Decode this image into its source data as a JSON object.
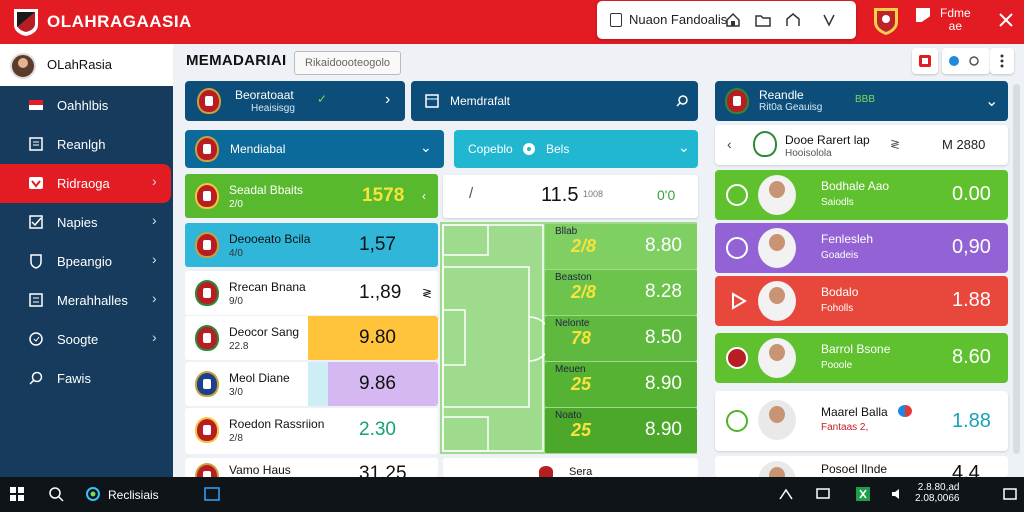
{
  "app": {
    "title": "OLAHRAGAASIA",
    "search_text": "Nuaon Fandoalis",
    "top_right_text": "Fdme\nae"
  },
  "sidebar": {
    "profile_name": "OLahRasia",
    "items": [
      {
        "label": "Oahhlbis",
        "icon": "flag-icon"
      },
      {
        "label": "Reanlgh",
        "icon": "document-icon"
      },
      {
        "label": "Ridraoga",
        "icon": "heart-icon",
        "active": true
      },
      {
        "label": "Napies",
        "icon": "check-icon"
      },
      {
        "label": "Bpeangio",
        "icon": "shield-icon"
      },
      {
        "label": "Merahhalles",
        "icon": "list-icon"
      },
      {
        "label": "Soogte",
        "icon": "chat-icon"
      },
      {
        "label": "Fawis",
        "icon": "search-icon"
      }
    ]
  },
  "header": {
    "title": "MEMADARIAI",
    "search_placeholder": "Rikaidoooteogolo"
  },
  "columns": {
    "left": {
      "title": "Beoratoaat",
      "subtitle": "Heaisisgg",
      "sub_header": "Mendiabal"
    },
    "middle": {
      "title": "Memdrafalt",
      "sub_header": "Copeblo",
      "sub_header2": "Bels"
    },
    "right": {
      "title": "Reandle",
      "subtitle": "Rit0a Geauisg",
      "badge": "BBB"
    }
  },
  "left_rows": [
    {
      "name": "Seadal Bbaits",
      "sub": "2/0",
      "odds": "1578"
    },
    {
      "name": "Deooeato Bcila",
      "sub": "4/0",
      "odds": "1,57"
    },
    {
      "name": "Rrecan Bnana",
      "sub": "9/0",
      "odds": "1.,89"
    },
    {
      "name": "Deocor Sang",
      "sub": "22.8",
      "odds": "9.80"
    },
    {
      "name": "Meol Diane",
      "sub": "3/0",
      "odds": "9.86"
    },
    {
      "name": "Roedon Rassriion",
      "sub": "2/8",
      "odds": "2.30"
    },
    {
      "name": "Vamo Haus",
      "sub": "",
      "odds": "31.25"
    }
  ],
  "middle_top": {
    "value": "11.5",
    "sub": "1008",
    "right": "0'0"
  },
  "pitch_rows": [
    {
      "score": "2/8",
      "odds": "8.80",
      "label": "Bllab"
    },
    {
      "score": "2/8",
      "odds": "8.28",
      "label": "Beaston"
    },
    {
      "score": "78",
      "odds": "8.50",
      "label": "Nelonte"
    },
    {
      "score": "25",
      "odds": "8.90",
      "label": "Meuen"
    },
    {
      "score": "25",
      "odds": "8.90",
      "label": "Noato"
    }
  ],
  "middle_bottom": {
    "label": "Sera"
  },
  "right_top": {
    "name": "Dooe Rarert lap",
    "sub": "Hooisolola",
    "value": "M 2880"
  },
  "right_rows": [
    {
      "name": "Bodhale Aao",
      "sub": "Saiodls",
      "value": "0.00",
      "color": "#5fc12e"
    },
    {
      "name": "Fenlesleh",
      "sub": "Goadeis",
      "value": "0,90",
      "color": "#9363d5"
    },
    {
      "name": "Bodalo",
      "sub": "Foholls",
      "value": "1.88",
      "color": "#e8483c"
    },
    {
      "name": "Barrol Bsone",
      "sub": "Pooole",
      "value": "8.60",
      "color": "#5fc12e"
    },
    {
      "name": "Maarel Balla",
      "sub": "Fantaas 2,",
      "value": "1.88",
      "color": "#ffffff"
    },
    {
      "name": "Posoel Ilnde",
      "sub": "",
      "value": "4.4",
      "color": "#ffffff"
    }
  ],
  "taskbar": {
    "label": "Reclisiais",
    "clock": "2.8.80,ad\n2.08,0066"
  }
}
